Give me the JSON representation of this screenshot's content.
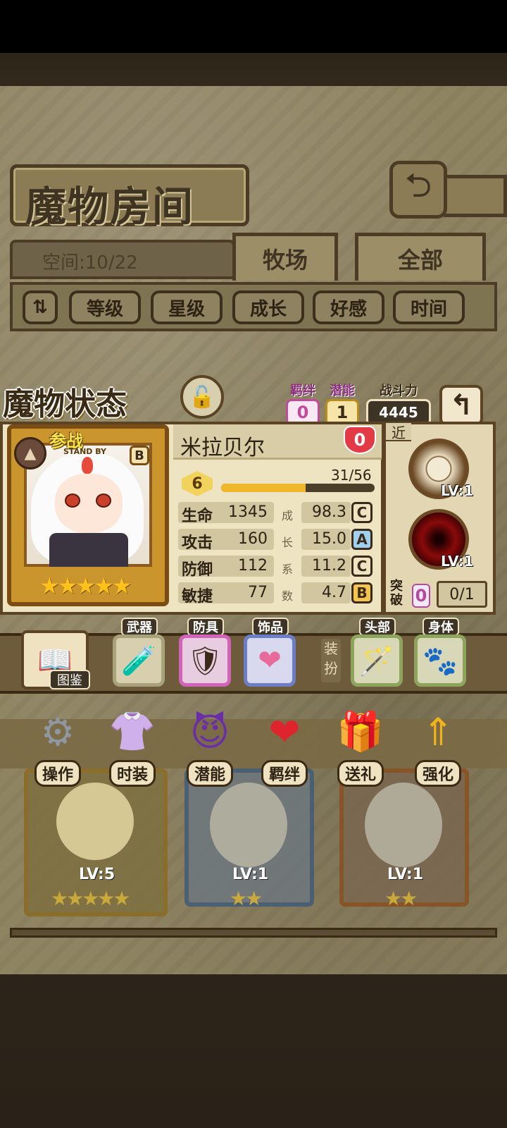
{
  "header": {
    "title": "魔物房间",
    "space": "空间:10/22",
    "tabs": [
      "牧场",
      "全部"
    ],
    "sort_buttons": [
      "等级",
      "星级",
      "成长",
      "好感",
      "时间"
    ]
  },
  "status": {
    "title": "魔物状态",
    "bond_label": "羁绊",
    "bond_value": "0",
    "potential_label": "潜能",
    "potential_value": "1",
    "power_label": "战斗力",
    "power_value": "4445"
  },
  "monster": {
    "standby": "参战",
    "standby_sub": "STAND BY",
    "rank": "B",
    "name": "米拉贝尔",
    "affection": "0",
    "level": "6",
    "exp_text": "31/56",
    "exp_progress": 0.55,
    "stars": "★★★★★",
    "stats": [
      {
        "name": "生命",
        "value": "1345",
        "growth": "98.3",
        "grade": "C"
      },
      {
        "name": "攻击",
        "value": "160",
        "growth": "15.0",
        "grade": "A"
      },
      {
        "name": "防御",
        "value": "112",
        "growth": "11.2",
        "grade": "C"
      },
      {
        "name": "敏捷",
        "value": "77",
        "growth": "4.7",
        "grade": "B"
      }
    ],
    "growth_chars": [
      "成",
      "长",
      "系",
      "数"
    ]
  },
  "skills": {
    "range_tag": "近",
    "skill1_lv": "LV:1",
    "skill2_lv": "LV:1",
    "break_label": "突破",
    "break_count": "0",
    "break_progress": "0/1"
  },
  "equipment": {
    "book_label": "图鉴",
    "weapon": "武器",
    "armor": "防具",
    "accessory": "饰品",
    "dress": "装扮",
    "head": "头部",
    "body": "身体"
  },
  "actions": [
    "操作",
    "时装",
    "潜能",
    "羁绊",
    "送礼",
    "强化"
  ],
  "background_cards": [
    {
      "lv": "LV:5",
      "stars": "★★★★★"
    },
    {
      "lv": "LV:1",
      "stars": "★★"
    },
    {
      "lv": "LV:1",
      "stars": "★★"
    }
  ],
  "colors": {
    "bond": "#c24a9b",
    "potential": "#b88d1d",
    "grade_c": "#efe4c2",
    "grade_a": "#9fd0ef",
    "grade_b": "#f2c44f",
    "weapon_slot": "#a7a27a",
    "armor_slot": "#d164b8",
    "accessory_slot": "#6c7fc6",
    "head_slot": "#8ea35c",
    "body_slot": "#8ea35c"
  }
}
